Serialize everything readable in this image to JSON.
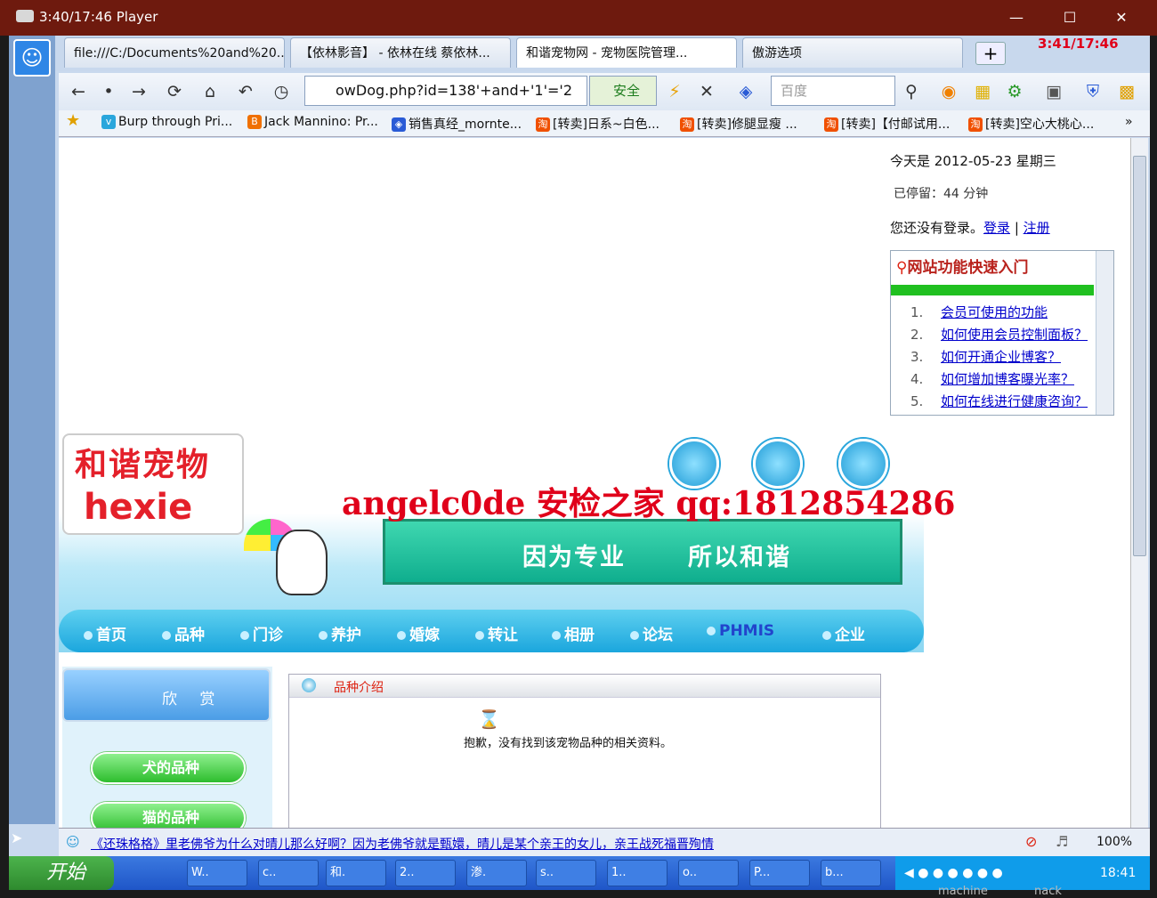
{
  "player": {
    "title": "3:40/17:46 Player",
    "overlay_time": "3:41/17:46"
  },
  "tabs": [
    {
      "label": "file:///C:/Documents%20and%20..."
    },
    {
      "label": "【依林影音】 - 依林在线 蔡依林..."
    },
    {
      "label": "和谐宠物网 - 宠物医院管理..."
    },
    {
      "label": "傲游选项"
    }
  ],
  "address": {
    "url": "owDog.php?id=138'+and+'1'='2",
    "security": "安全",
    "search_placeholder": "百度"
  },
  "favorites": [
    {
      "label": "Burp through Pri..."
    },
    {
      "label": "Jack Mannino: Pr..."
    },
    {
      "label": "销售真经_mornte..."
    },
    {
      "label": "[转卖]日系~白色..."
    },
    {
      "label": "[转卖]修腿显瘦 ..."
    },
    {
      "label": "[转卖]【付邮试用..."
    },
    {
      "label": "[转卖]空心大桃心..."
    }
  ],
  "page": {
    "date": "今天是 2012-05-23 星期三",
    "stay": "已停留：44 分钟",
    "login_prefix": "您还没有登录。",
    "login_link": "登录",
    "sep": "|",
    "register_link": "注册",
    "quick": {
      "title": "网站功能快速入门",
      "items": [
        {
          "num": "1.",
          "text": "会员可使用的功能"
        },
        {
          "num": "2.",
          "text": "如何使用会员控制面板？"
        },
        {
          "num": "3.",
          "text": "如何开通企业博客？"
        },
        {
          "num": "4.",
          "text": "如何增加博客曝光率？"
        },
        {
          "num": "5.",
          "text": "如何在线进行健康咨询？"
        }
      ]
    },
    "logo_line1": "和谐宠物",
    "logo_line2": "hexie",
    "watermark": "angelc0de 安检之家 qq:1812854286",
    "slogan_left": "因为专业",
    "slogan_right": "所以和谐",
    "menu": [
      "首页",
      "品种",
      "门诊",
      "养护",
      "婚嫁",
      "转让",
      "相册",
      "论坛",
      "PHMIS",
      "企业"
    ],
    "side_title": "欣 赏",
    "side_buttons": [
      "犬的品种",
      "猫的品种"
    ],
    "section_title": "品种介绍",
    "sorry": "抱歉，没有找到该宠物品种的相关资料。"
  },
  "status": {
    "ticker": "《还珠格格》里老佛爷为什么对晴儿那么好啊？因为老佛爷就是甄嬛，晴儿是某个亲王的女儿，亲王战死福晋殉情",
    "zoom": "100%"
  },
  "taskbar": {
    "start": "开始",
    "items": [
      "W..",
      "c..",
      "和.",
      "2..",
      "渗.",
      "s..",
      "1..",
      "o..",
      "P...",
      "b..."
    ],
    "clock": "18:41"
  },
  "machine_labels": [
    "machine",
    "nack"
  ],
  "colors": {
    "outer_title": "#6e1a0e",
    "menu": "#1ba6dd",
    "watermark": "#e0001a"
  }
}
